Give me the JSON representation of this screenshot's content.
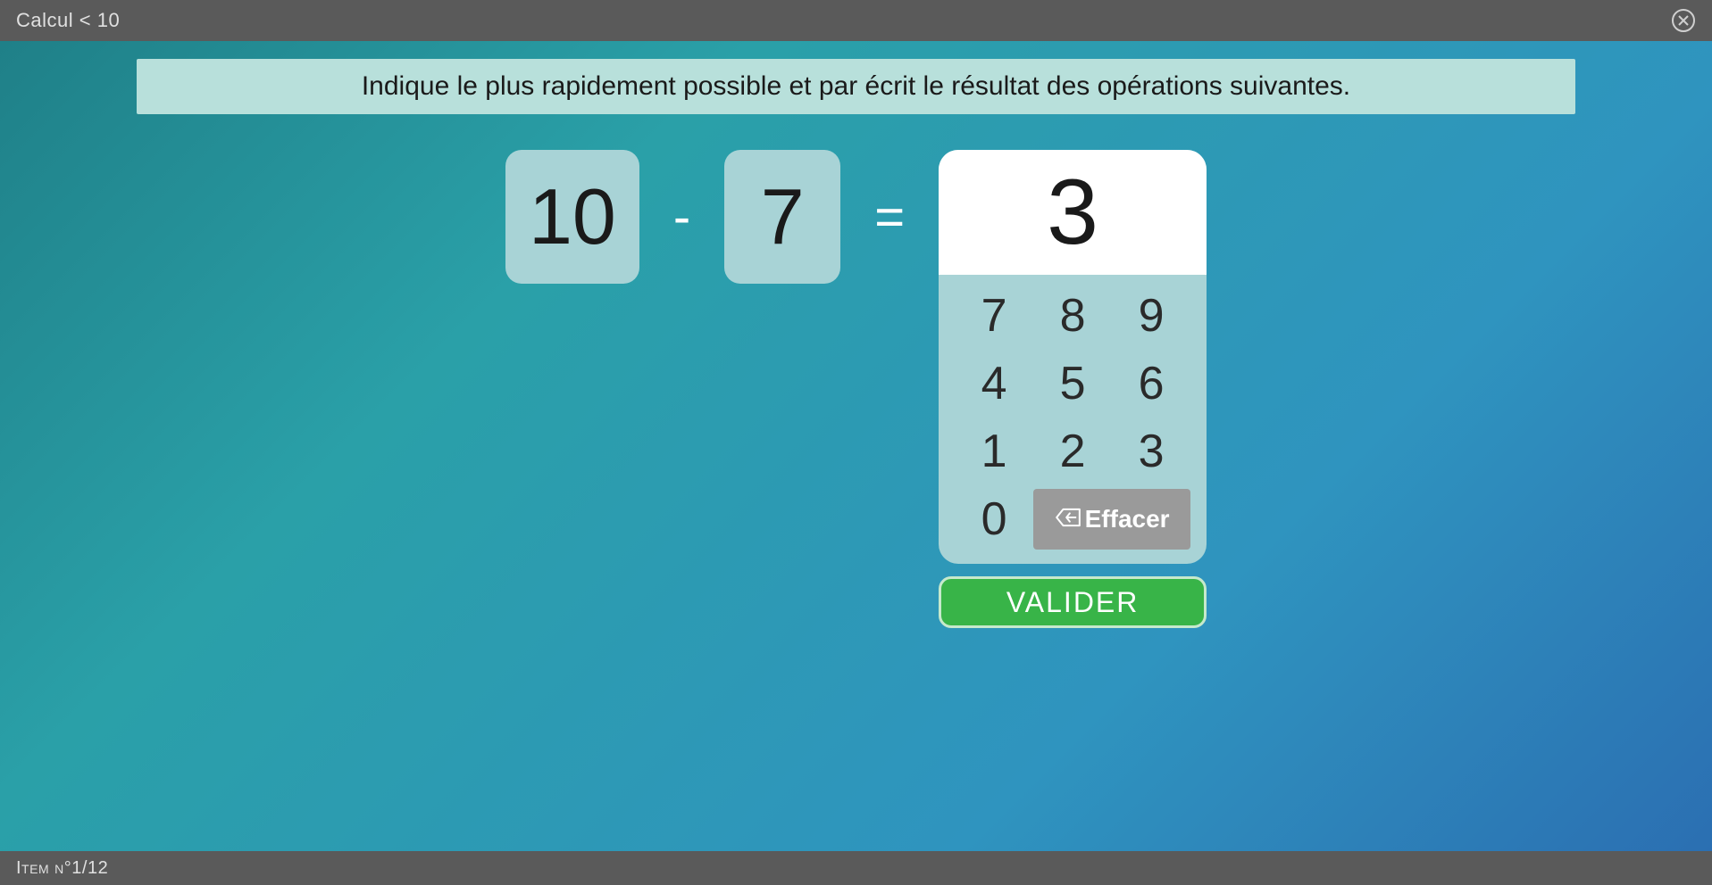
{
  "topbar": {
    "title": "Calcul < 10"
  },
  "instruction": "Indique le plus rapidement possible et par écrit le résultat des opérations suivantes.",
  "equation": {
    "operand_a": "10",
    "operator": "-",
    "operand_b": "7",
    "equals": "=",
    "input_value": "3"
  },
  "keypad": {
    "keys_row1": [
      "7",
      "8",
      "9"
    ],
    "keys_row2": [
      "4",
      "5",
      "6"
    ],
    "keys_row3": [
      "1",
      "2",
      "3"
    ],
    "key_zero": "0",
    "erase_label": "Effacer"
  },
  "validate_label": "VALIDER",
  "footer": {
    "item_label": "Item n°1/12"
  },
  "colors": {
    "accent_green": "#38b448",
    "panel_teal": "#a8d3d6",
    "banner_teal": "#b8e0db",
    "chrome_grey": "#5a5a5a"
  }
}
